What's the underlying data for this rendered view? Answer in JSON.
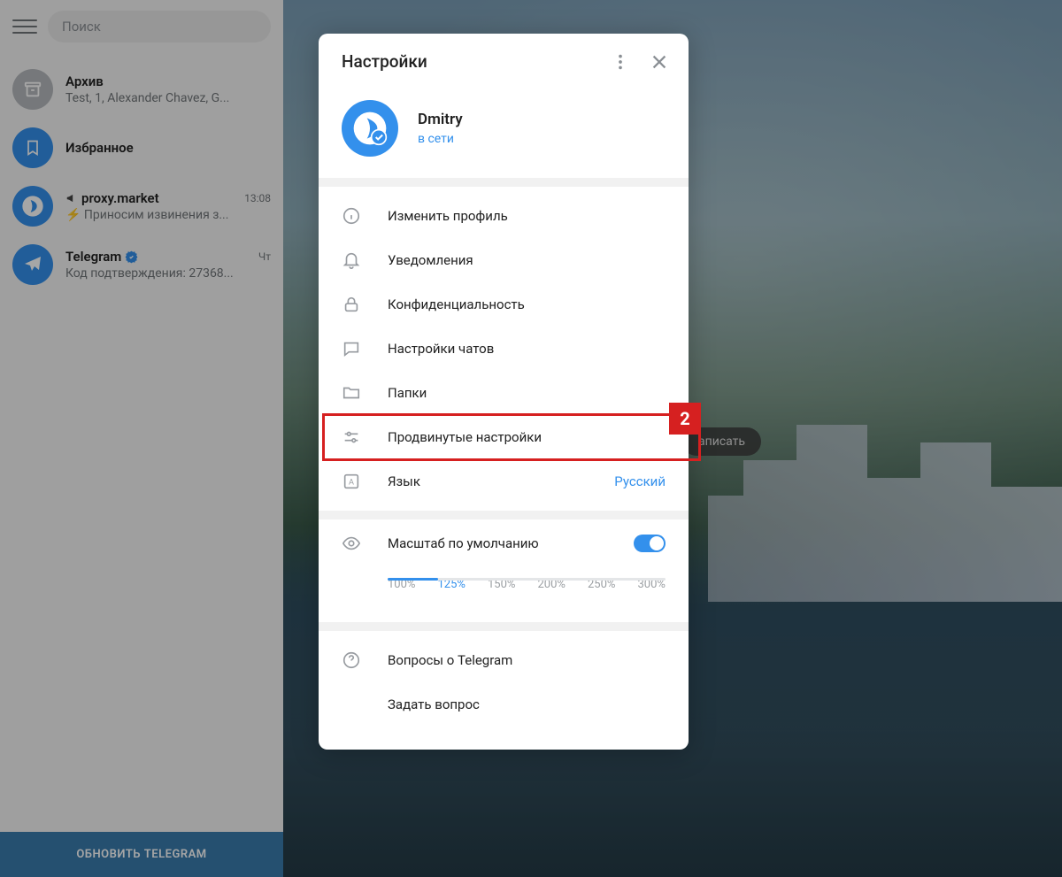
{
  "colors": {
    "accent": "#3390ec",
    "highlight": "#d62020"
  },
  "sidebar": {
    "search_placeholder": "Поиск",
    "update_label": "ОБНОВИТЬ TELEGRAM",
    "chats": [
      {
        "title": "Архив",
        "subtitle": "Test, 1, Alexander Chavez, G...",
        "time": "",
        "avatar": "archive"
      },
      {
        "title": "Избранное",
        "subtitle": "",
        "time": "",
        "avatar": "saved"
      },
      {
        "title": "proxy.market",
        "subtitle": "⚡ Приносим извинения з...",
        "time": "13:08",
        "avatar": "proxy",
        "channel": true
      },
      {
        "title": "Telegram",
        "subtitle": "Код подтверждения: 27368...",
        "time": "Чт",
        "avatar": "telegram",
        "verified": true
      }
    ]
  },
  "record_chip": "аписать",
  "modal": {
    "title": "Настройки",
    "profile": {
      "name": "Dmitry",
      "status": "в сети"
    },
    "menu": [
      {
        "icon": "info",
        "label": "Изменить профиль"
      },
      {
        "icon": "bell",
        "label": "Уведомления"
      },
      {
        "icon": "lock",
        "label": "Конфиденциальность"
      },
      {
        "icon": "chat",
        "label": "Настройки чатов"
      },
      {
        "icon": "folder",
        "label": "Папки"
      },
      {
        "icon": "sliders",
        "label": "Продвинутые настройки",
        "highlighted": true,
        "badge": "2"
      },
      {
        "icon": "language",
        "label": "Язык",
        "value": "Русский"
      }
    ],
    "scale": {
      "label": "Масштаб по умолчанию",
      "toggle": true,
      "options": [
        "100%",
        "125%",
        "150%",
        "200%",
        "250%",
        "300%"
      ],
      "active_index": 1
    },
    "footer": [
      {
        "icon": "help",
        "label": "Вопросы о Telegram"
      },
      {
        "icon": "",
        "label": "Задать вопрос"
      }
    ]
  }
}
